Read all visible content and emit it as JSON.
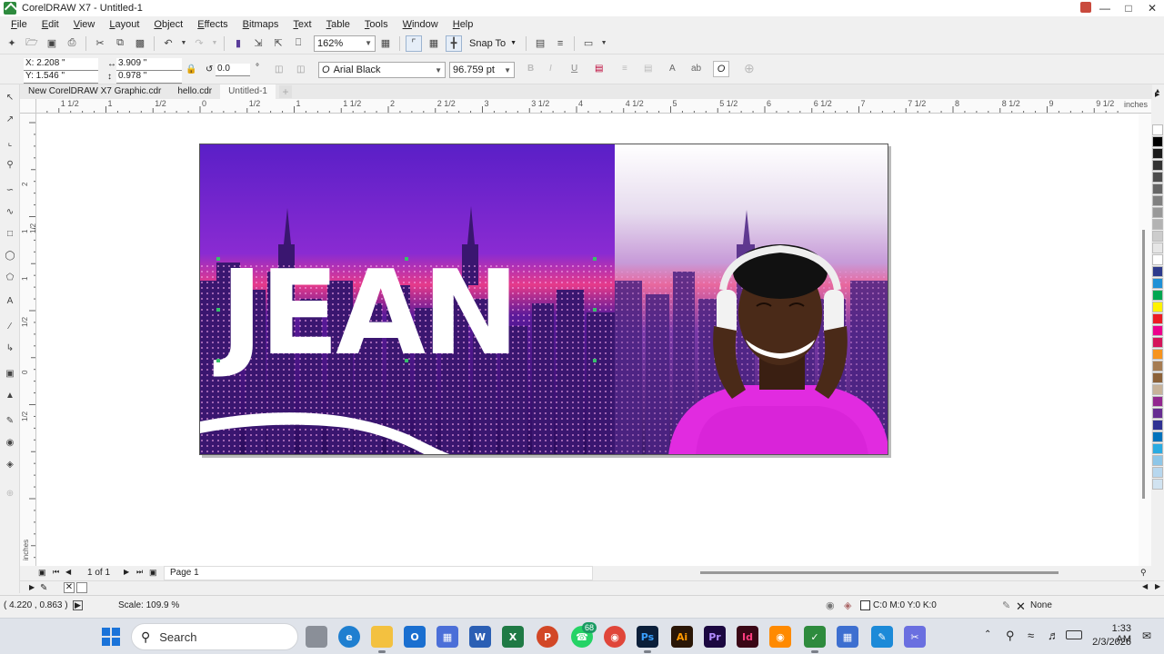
{
  "window": {
    "title": "CorelDRAW X7 - Untitled-1"
  },
  "menu": [
    "File",
    "Edit",
    "View",
    "Layout",
    "Object",
    "Effects",
    "Bitmaps",
    "Text",
    "Table",
    "Tools",
    "Window",
    "Help"
  ],
  "standard_toolbar": {
    "zoom": "162%",
    "snap_to": "Snap To"
  },
  "property_bar": {
    "x": "X: 2.208 \"",
    "y": "Y: 1.546 \"",
    "width": "3.909 \"",
    "height": "0.978 \"",
    "rotation": "0.0",
    "degree": "°",
    "font": "Arial Black",
    "font_size": "96.759 pt"
  },
  "doc_tabs": [
    "New CorelDRAW X7 Graphic.cdr",
    "hello.cdr",
    "Untitled-1"
  ],
  "ruler": {
    "h_labels": [
      "1 1/2",
      "1",
      "1/2",
      "0",
      "1/2",
      "1",
      "1 1/2",
      "2",
      "2 1/2",
      "3",
      "3 1/2",
      "4",
      "4 1/2",
      "5",
      "5 1/2",
      "6",
      "6 1/2",
      "7",
      "7 1/2",
      "8",
      "8 1/2",
      "9",
      "9 1/2"
    ],
    "h_unit": "inches",
    "v_labels": [
      "2",
      "1 1/2",
      "1",
      "1/2",
      "0",
      "1/2"
    ],
    "v_unit": "inches"
  },
  "design": {
    "headline": "JEAN"
  },
  "page_nav": {
    "page_count": "1 of 1",
    "page_tab": "Page 1"
  },
  "status": {
    "cursor": "( 4.220 , 0.863 )",
    "scale": "Scale: 109.9 %",
    "fill": "C:0 M:0 Y:0 K:0",
    "outline": "None"
  },
  "taskbar": {
    "search": "Search",
    "whatsapp_badge": "68",
    "time": "1:33 AM",
    "date": "2/3/2026"
  },
  "palette_colors": [
    "#ffffff",
    "#000000",
    "#1a1a1a",
    "#333333",
    "#4d4d4d",
    "#666666",
    "#808080",
    "#999999",
    "#b3b3b3",
    "#cccccc",
    "#e6e6e6",
    "#ffffff",
    "#2d3a8c",
    "#1e90d6",
    "#00a651",
    "#fff200",
    "#ed1c24",
    "#ec008c",
    "#d4145a",
    "#f7941d",
    "#a67c52",
    "#8c6239",
    "#c7b299",
    "#92278f",
    "#662d91",
    "#2e3192",
    "#0072bc",
    "#29abe2",
    "#8dc6e8",
    "#b7d7ee",
    "#d1e3f1"
  ]
}
